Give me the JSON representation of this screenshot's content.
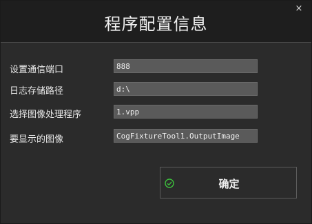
{
  "window": {
    "title": "程序配置信息",
    "close_label": "×"
  },
  "form": {
    "rows": [
      {
        "label": "设置通信端口",
        "value": "888"
      },
      {
        "label": "日志存储路径",
        "value": "d:\\"
      },
      {
        "label": "选择图像处理程序",
        "value": "1.vpp"
      },
      {
        "label": "要显示的图像",
        "value": "CogFixtureTool1.OutputImage"
      }
    ]
  },
  "actions": {
    "ok_label": "确定",
    "ok_icon": "check-circle-icon",
    "ok_icon_color": "#3cbf3c"
  },
  "colors": {
    "background": "#2b2b2b",
    "titlebar": "#1e1e1e",
    "field_bg": "#5a5a5a",
    "text": "#f0f0f0"
  }
}
